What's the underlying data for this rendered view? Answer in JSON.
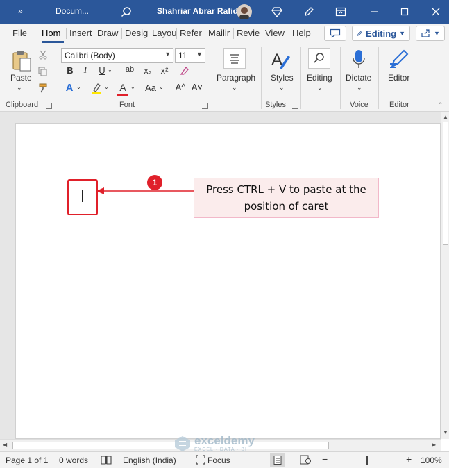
{
  "titlebar": {
    "more_glyph": "»",
    "doc_title": "Docum...",
    "user_name": "Shahriar Abrar Rafid",
    "bg_color": "#2b579a"
  },
  "tabs": [
    {
      "label": "File"
    },
    {
      "label": "Hom"
    },
    {
      "label": "Insert"
    },
    {
      "label": "Draw"
    },
    {
      "label": "Desig"
    },
    {
      "label": "Layou"
    },
    {
      "label": "Refer"
    },
    {
      "label": "Mailir"
    },
    {
      "label": "Revie"
    },
    {
      "label": "View"
    },
    {
      "label": "Help"
    }
  ],
  "mode_button": "Editing",
  "ribbon": {
    "clipboard": {
      "paste_label": "Paste",
      "group_label": "Clipboard"
    },
    "font": {
      "font_name": "Calibri (Body)",
      "font_size": "11",
      "bold": "B",
      "italic": "I",
      "underline": "U",
      "strike": "ab",
      "subscript": "x₂",
      "superscript": "x²",
      "font_color": "A",
      "text_effects": "A",
      "case": "Aa",
      "grow": "A^",
      "shrink": "A˅",
      "group_label": "Font"
    },
    "paragraph": {
      "label": "Paragraph"
    },
    "styles": {
      "label": "Styles",
      "group_label": "Styles"
    },
    "editing": {
      "label": "Editing"
    },
    "voice": {
      "label": "Dictate",
      "group_label": "Voice"
    },
    "editor": {
      "label": "Editor",
      "group_label": "Editor"
    }
  },
  "annotation": {
    "step_number": "1",
    "callout_line1": "Press CTRL + V to paste at the",
    "callout_line2": "position of caret",
    "accent_color": "#e0202a"
  },
  "watermark": {
    "brand": "exceldemy",
    "tagline": "EXCEL · DATA · BI"
  },
  "statusbar": {
    "page": "Page 1 of 1",
    "words": "0 words",
    "language": "English (India)",
    "focus": "Focus",
    "zoom_minus": "−",
    "zoom_plus": "+",
    "zoom": "100%"
  }
}
